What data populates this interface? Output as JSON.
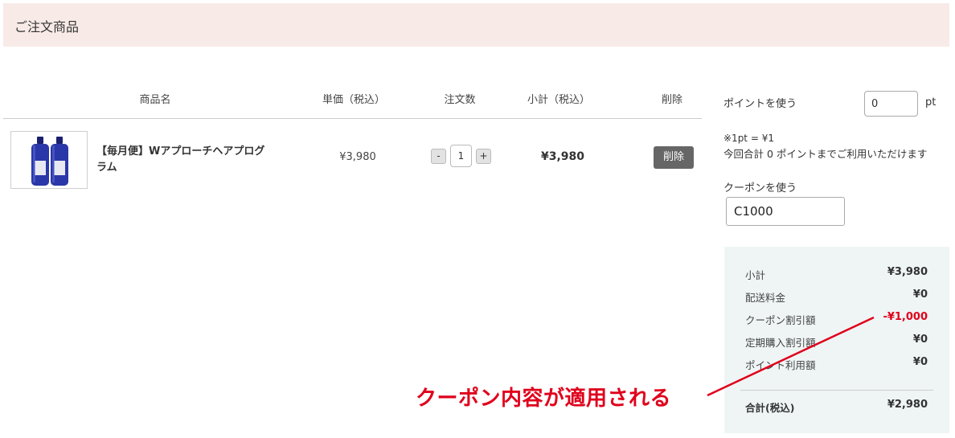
{
  "section": {
    "title": "ご注文商品"
  },
  "table": {
    "headers": {
      "product": "商品名",
      "unit_price": "単価（税込）",
      "quantity": "注文数",
      "subtotal": "小計（税込）",
      "delete": "削除"
    },
    "item": {
      "name": "【毎月便】Wアプローチヘアプログラム",
      "unit_price": "¥3,980",
      "quantity": "1",
      "minus": "-",
      "plus": "+",
      "subtotal": "¥3,980",
      "delete_label": "削除",
      "thumbnail_colors": {
        "bottle": "#2a37a8",
        "cap": "#1a2070",
        "label": "#e8e8f0"
      }
    }
  },
  "points": {
    "label": "ポイントを使う",
    "value": "0",
    "unit": "pt",
    "rate": "※1pt = ¥1",
    "limit_text": "今回合計 0 ポイントまでご利用いただけます"
  },
  "coupon": {
    "label": "クーポンを使う",
    "value": "C1000"
  },
  "summary": {
    "subtotal_label": "小計",
    "subtotal_value": "¥3,980",
    "shipping_label": "配送料金",
    "shipping_value": "¥0",
    "coupon_discount_label": "クーポン割引額",
    "coupon_discount_value": "-¥1,000",
    "subscription_discount_label": "定期購入割引額",
    "subscription_discount_value": "¥0",
    "points_used_label": "ポイント利用額",
    "points_used_value": "¥0",
    "total_label": "合計(税込)",
    "total_value": "¥2,980"
  },
  "annotation": {
    "text": "クーポン内容が適用される",
    "color": "#e0001b"
  }
}
